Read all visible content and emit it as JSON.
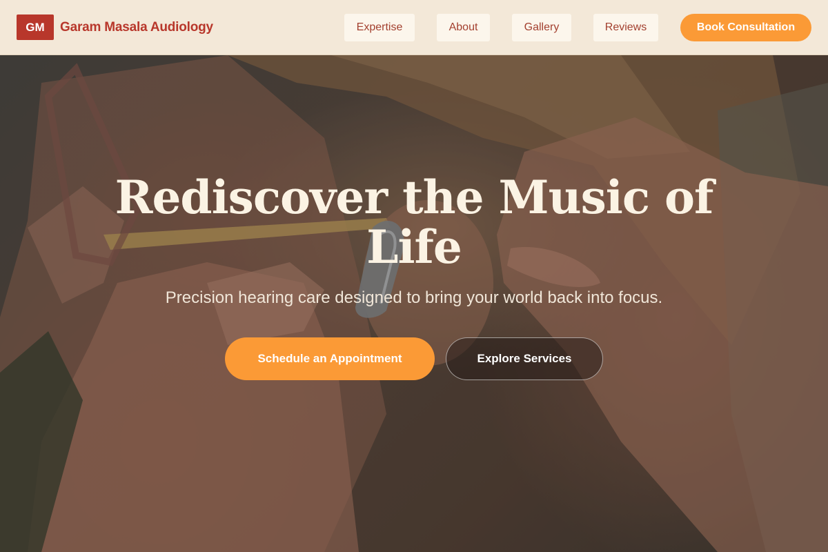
{
  "brand": {
    "badge": "GM",
    "name": "Garam Masala Audiology"
  },
  "nav": {
    "items": [
      {
        "label": "Expertise"
      },
      {
        "label": "About"
      },
      {
        "label": "Gallery"
      },
      {
        "label": "Reviews"
      }
    ],
    "cta_label": "Book Consultation"
  },
  "hero": {
    "title": "Rediscover the Music of Life",
    "subtitle": "Precision hearing care designed to bring your world back into focus.",
    "primary_button": "Schedule an Appointment",
    "secondary_button": "Explore Services",
    "image_description_icon": "hearing-aid-fitting-photo-icon"
  },
  "colors": {
    "brand_red": "#b8372b",
    "accent_orange": "#fb9a36",
    "header_bg": "#f3e8d8",
    "nav_pill_bg": "#fcf6ec"
  }
}
